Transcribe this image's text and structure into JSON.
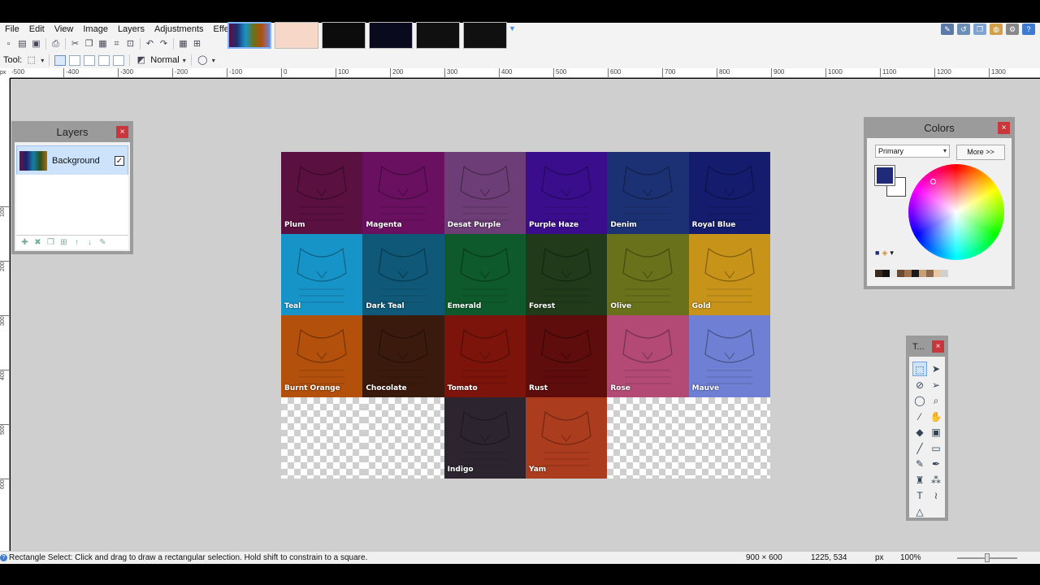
{
  "menu": [
    "File",
    "Edit",
    "View",
    "Image",
    "Layers",
    "Adjustments",
    "Effects"
  ],
  "options_bar": {
    "tool_label": "Tool:",
    "blend_mode": "Normal"
  },
  "ruler_h": [
    "-500",
    "-400",
    "-300",
    "-200",
    "-100",
    "0",
    "100",
    "200",
    "300",
    "400",
    "500",
    "600",
    "700",
    "800",
    "900",
    "1000",
    "1100",
    "1200",
    "1300"
  ],
  "ruler_v": [
    "100",
    "200",
    "300",
    "400",
    "500",
    "600"
  ],
  "canvas": {
    "tiles": [
      {
        "label": "Plum",
        "color": "#5a1040"
      },
      {
        "label": "Magenta",
        "color": "#6a1060"
      },
      {
        "label": "Desat Purple",
        "color": "#6c3d76"
      },
      {
        "label": "Purple Haze",
        "color": "#3a0d8c"
      },
      {
        "label": "Denim",
        "color": "#1c3174"
      },
      {
        "label": "Royal Blue",
        "color": "#141c6e"
      },
      {
        "label": "Teal",
        "color": "#1694c8"
      },
      {
        "label": "Dark Teal",
        "color": "#0f5878"
      },
      {
        "label": "Emerald",
        "color": "#0e5a2c"
      },
      {
        "label": "Forest",
        "color": "#213a1a"
      },
      {
        "label": "Olive",
        "color": "#69721a"
      },
      {
        "label": "Gold",
        "color": "#c79318"
      },
      {
        "label": "Burnt Orange",
        "color": "#b2500c"
      },
      {
        "label": "Chocolate",
        "color": "#3a1a0c"
      },
      {
        "label": "Tomato",
        "color": "#7c140c"
      },
      {
        "label": "Rust",
        "color": "#5e0c0c"
      },
      {
        "label": "Rose",
        "color": "#b34a76"
      },
      {
        "label": "Mauve",
        "color": "#6f7fd4"
      },
      {
        "label": "",
        "color": ""
      },
      {
        "label": "",
        "color": ""
      },
      {
        "label": "Indigo",
        "color": "#2c2530"
      },
      {
        "label": "Yam",
        "color": "#ac3c1e"
      },
      {
        "label": "",
        "color": ""
      },
      {
        "label": "",
        "color": ""
      }
    ]
  },
  "layers_panel": {
    "title": "Layers",
    "close": "×",
    "layer_name": "Background",
    "check": "✓"
  },
  "colors_panel": {
    "title": "Colors",
    "close": "×",
    "mode": "Primary",
    "more": "More >>",
    "primary_color": "#1f2a78",
    "palette": [
      "#3a2a1e",
      "#111111",
      "#e8e8e8",
      "#6a4a30",
      "#a0704a",
      "#1a1a1a",
      "#c8a078",
      "#8a6a4a",
      "#e8c8a0",
      "#d0d0d0"
    ]
  },
  "tools_panel": {
    "title": "T...",
    "close": "×"
  },
  "status": {
    "hint": "Rectangle Select: Click and drag to draw a rectangular selection. Hold shift to constrain to a square.",
    "image_size": "900 × 600",
    "cursor_pos": "1225, 534",
    "unit": "px",
    "zoom": "100%"
  }
}
